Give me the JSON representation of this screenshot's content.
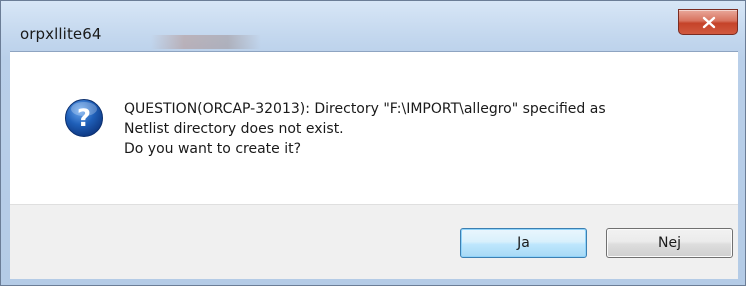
{
  "window": {
    "title": "orpxllite64",
    "close_icon": "close-icon"
  },
  "dialog": {
    "icon": "question-icon",
    "message_lines": [
      "QUESTION(ORCAP-32013): Directory \"F:\\IMPORT\\allegro\" specified as",
      "Netlist directory does not exist.",
      "Do you want to create it?"
    ]
  },
  "buttons": {
    "yes_label": "Ja",
    "no_label": "Nej"
  },
  "colors": {
    "frame": "#c3d7ee",
    "close_button": "#c5432a",
    "icon_blue": "#1f5fb8",
    "default_button_border": "#3c7fb1"
  }
}
